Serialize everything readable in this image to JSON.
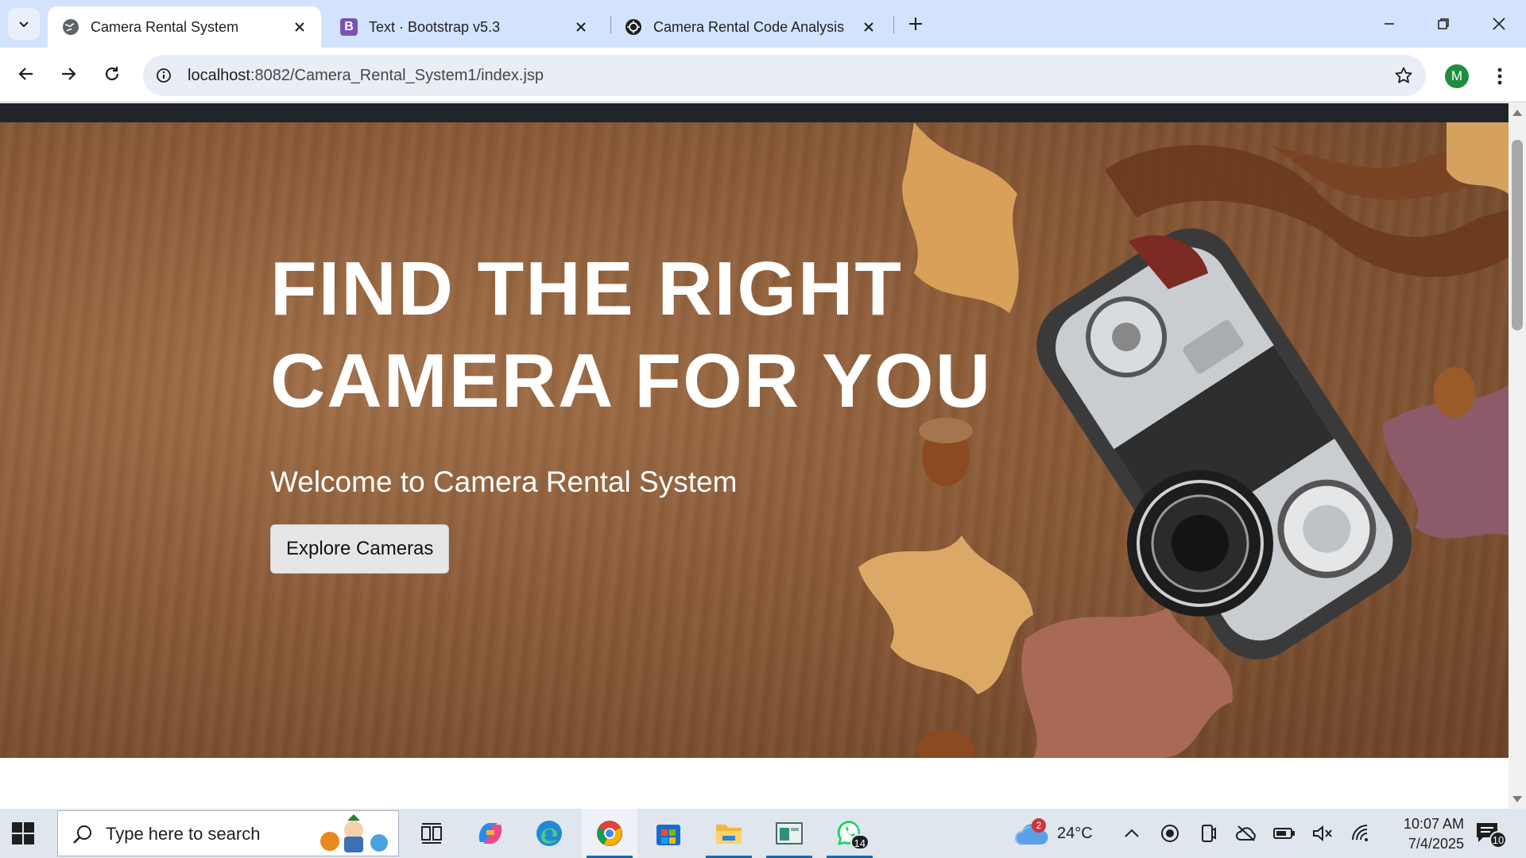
{
  "browser": {
    "tabs": [
      {
        "title": "Camera Rental System",
        "active": true
      },
      {
        "title": "Text · Bootstrap v5.3",
        "active": false,
        "favicon_letter": "B"
      },
      {
        "title": "Camera Rental Code Analysis",
        "active": false
      }
    ],
    "url_host": "localhost",
    "url_path": ":8082/Camera_Rental_System1/index.jsp",
    "profile_initial": "M"
  },
  "page": {
    "hero": {
      "title": "FIND THE RIGHT CAMERA FOR YOU",
      "subtitle": "Welcome to Camera Rental System",
      "button_label": "Explore Cameras"
    }
  },
  "taskbar": {
    "search_placeholder": "Type here to search",
    "apps": [
      {
        "name": "task-view"
      },
      {
        "name": "copilot"
      },
      {
        "name": "edge"
      },
      {
        "name": "chrome",
        "running": true,
        "active": true
      },
      {
        "name": "microsoft-store"
      },
      {
        "name": "file-explorer",
        "running": true
      },
      {
        "name": "app-window",
        "running": true
      },
      {
        "name": "whatsapp",
        "running": true,
        "badge": "14"
      }
    ],
    "weather": {
      "temp": "24°C",
      "badge": "2"
    },
    "clock": {
      "time": "10:07 AM",
      "date": "7/4/2025"
    },
    "notifications_badge": "10"
  },
  "colors": {
    "tabstrip": "#d3e3fd",
    "navbar_dark": "#212529",
    "hero_wood": "#8a5a37",
    "avatar": "#1e8e3e",
    "taskbar": "#dfe6ee"
  }
}
